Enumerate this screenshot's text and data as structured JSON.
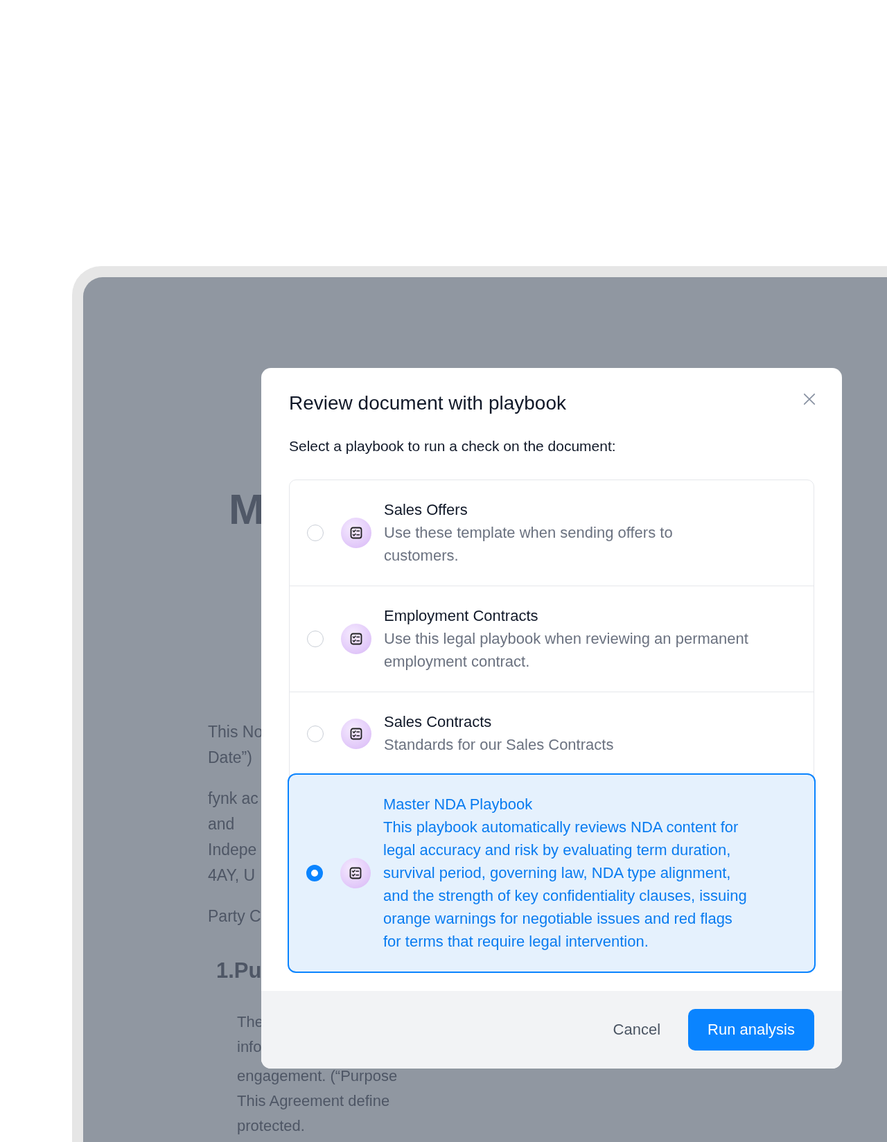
{
  "document": {
    "title_fragment": "M",
    "blocks": [
      {
        "kind": "para",
        "lines": [
          "This No",
          "Date”)"
        ]
      },
      {
        "kind": "para",
        "lines": [
          "fynk ac",
          "and",
          "Indepe",
          "4AY, U"
        ]
      },
      {
        "kind": "para",
        "lines": [
          "Party C"
        ]
      },
      {
        "kind": "heading",
        "lines": [
          "1.Pu"
        ]
      },
      {
        "kind": "indented",
        "lines": [
          "The",
          "info",
          "engagement. (“Purpose",
          "This Agreement define",
          "protected."
        ]
      }
    ]
  },
  "dialog": {
    "title": "Review document with playbook",
    "prompt": "Select a playbook to run a check on the document:",
    "options": [
      {
        "title": "Sales Offers",
        "description": "Use these template when sending offers to customers.",
        "selected": false
      },
      {
        "title": "Employment Contracts",
        "description": "Use this legal playbook when reviewing an permanent employment contract.",
        "selected": false
      },
      {
        "title": "Sales Contracts",
        "description": "Standards for our Sales Contracts",
        "selected": false
      },
      {
        "title": "Master NDA Playbook",
        "description": "This playbook automatically reviews NDA content for legal accuracy and risk by evaluating term duration, survival period, governing law, NDA type alignment, and the strength of key confidentiality clauses, issuing orange warnings for negotiable issues and red flags for terms that require legal intervention.",
        "selected": true
      }
    ],
    "buttons": [
      {
        "label": "Cancel",
        "kind": "secondary"
      },
      {
        "label": "Run analysis",
        "kind": "primary"
      }
    ]
  }
}
